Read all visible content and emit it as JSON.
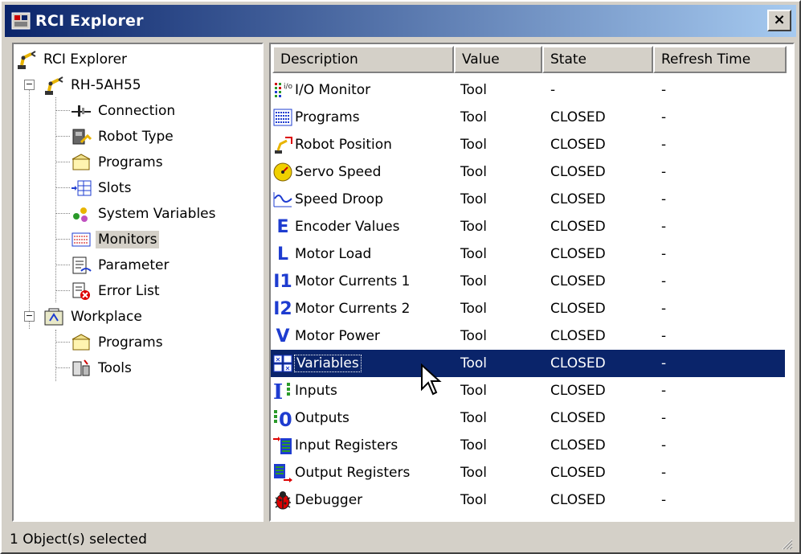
{
  "window": {
    "title": "RCI Explorer",
    "close_label": "×"
  },
  "tree": {
    "root": "RCI Explorer",
    "robot": "RH-5AH55",
    "robot_children": [
      "Connection",
      "Robot Type",
      "Programs",
      "Slots",
      "System Variables",
      "Monitors",
      "Parameter",
      "Error List"
    ],
    "workplace": "Workplace",
    "workplace_children": [
      "Programs",
      "Tools"
    ],
    "selected": "Monitors"
  },
  "list": {
    "columns": [
      "Description",
      "Value",
      "State",
      "Refresh Time"
    ],
    "rows": [
      {
        "icon": "io-monitor-icon",
        "description": "I/O Monitor",
        "value": "Tool",
        "state": "-",
        "refresh": "-"
      },
      {
        "icon": "programs-icon",
        "description": "Programs",
        "value": "Tool",
        "state": "CLOSED",
        "refresh": "-"
      },
      {
        "icon": "robot-position-icon",
        "description": "Robot Position",
        "value": "Tool",
        "state": "CLOSED",
        "refresh": "-"
      },
      {
        "icon": "servo-speed-icon",
        "description": "Servo Speed",
        "value": "Tool",
        "state": "CLOSED",
        "refresh": "-"
      },
      {
        "icon": "speed-droop-icon",
        "description": "Speed Droop",
        "value": "Tool",
        "state": "CLOSED",
        "refresh": "-"
      },
      {
        "icon": "E",
        "description": "Encoder Values",
        "value": "Tool",
        "state": "CLOSED",
        "refresh": "-"
      },
      {
        "icon": "L",
        "description": "Motor Load",
        "value": "Tool",
        "state": "CLOSED",
        "refresh": "-"
      },
      {
        "icon": "I1",
        "description": "Motor Currents 1",
        "value": "Tool",
        "state": "CLOSED",
        "refresh": "-"
      },
      {
        "icon": "I2",
        "description": "Motor Currents 2",
        "value": "Tool",
        "state": "CLOSED",
        "refresh": "-"
      },
      {
        "icon": "V",
        "description": "Motor Power",
        "value": "Tool",
        "state": "CLOSED",
        "refresh": "-"
      },
      {
        "icon": "variables-icon",
        "description": "Variables",
        "value": "Tool",
        "state": "CLOSED",
        "refresh": "-"
      },
      {
        "icon": "inputs-icon",
        "description": "Inputs",
        "value": "Tool",
        "state": "CLOSED",
        "refresh": "-"
      },
      {
        "icon": "outputs-icon",
        "description": "Outputs",
        "value": "Tool",
        "state": "CLOSED",
        "refresh": "-"
      },
      {
        "icon": "input-registers-icon",
        "description": "Input Registers",
        "value": "Tool",
        "state": "CLOSED",
        "refresh": "-"
      },
      {
        "icon": "output-registers-icon",
        "description": "Output Registers",
        "value": "Tool",
        "state": "CLOSED",
        "refresh": "-"
      },
      {
        "icon": "debugger-icon",
        "description": "Debugger",
        "value": "Tool",
        "state": "CLOSED",
        "refresh": "-"
      }
    ],
    "selected_index": 10
  },
  "status": {
    "text": "1 Object(s) selected"
  },
  "colors": {
    "title_start": "#0a246a",
    "title_end": "#a6caf0",
    "selection": "#0a246a",
    "face": "#d4d0c8",
    "letter_icon": "#1e3cd0"
  }
}
